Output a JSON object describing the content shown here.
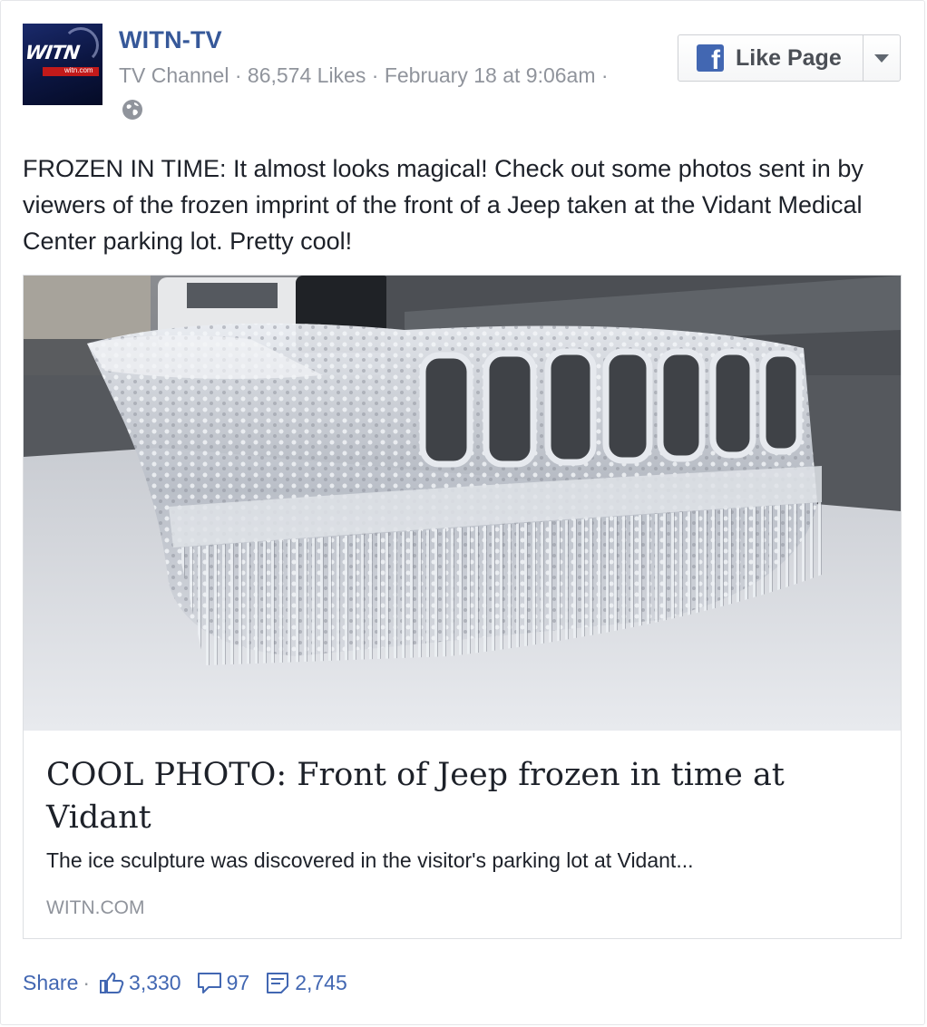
{
  "header": {
    "page_name": "WITN-TV",
    "category": "TV Channel",
    "likes": "86,574 Likes",
    "date": "February 18 at 9:06am",
    "sep": "·",
    "avatar": {
      "logo_text": "WITN",
      "logo_sub": "witn.com"
    }
  },
  "like_button": {
    "label": "Like Page",
    "icon": "facebook-f-icon"
  },
  "post": {
    "text": "FROZEN IN TIME: It almost looks magical! Check out some photos sent in by viewers of the frozen imprint of the front of a Jeep taken at the Vidant Medical Center parking lot. Pretty cool!"
  },
  "link_preview": {
    "title": "COOL PHOTO: Front of Jeep frozen in time at Vidant",
    "description": "The ice sculpture was discovered in the visitor's parking lot at Vidant...",
    "domain": "WITN.COM"
  },
  "footer": {
    "share": "Share",
    "dot": "·",
    "likes": "3,330",
    "comments": "97",
    "shares": "2,745"
  },
  "colors": {
    "link": "#365899",
    "accent": "#4267b2",
    "meta": "#90949c"
  }
}
